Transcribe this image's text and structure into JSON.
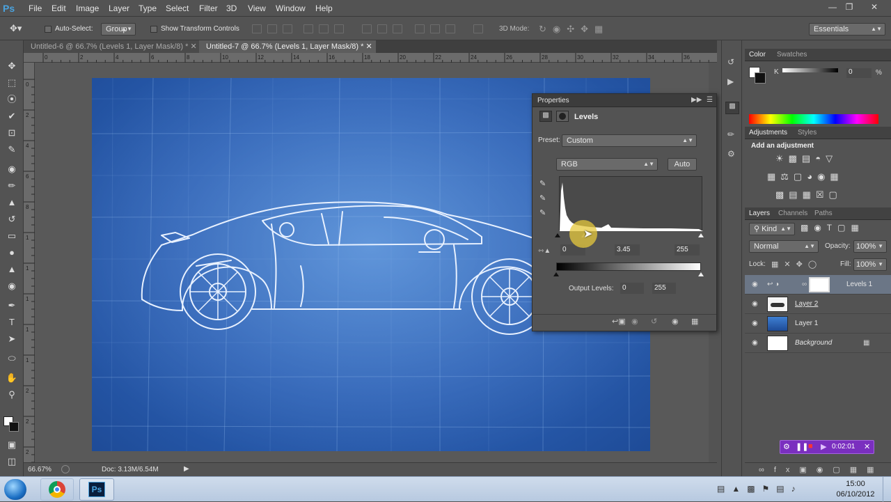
{
  "app": {
    "logo": "Ps"
  },
  "menu": [
    "File",
    "Edit",
    "Image",
    "Layer",
    "Type",
    "Select",
    "Filter",
    "3D",
    "View",
    "Window",
    "Help"
  ],
  "window_controls": [
    "minimize-icon",
    "restore-icon",
    "close-icon"
  ],
  "options": {
    "auto_select_label": "Auto-Select:",
    "auto_select_value": "Group",
    "show_transform_label": "Show Transform Controls",
    "mode_3d_label": "3D Mode:",
    "workspace": "Essentials"
  },
  "tabs": [
    {
      "label": "Untitled-6 @ 66.7% (Levels 1, Layer Mask/8) *",
      "active": false
    },
    {
      "label": "Untitled-7 @ 66.7% (Levels 1, Layer Mask/8) *",
      "active": true
    }
  ],
  "ruler_top_ticks": [
    "0",
    "2",
    "4",
    "6",
    "8",
    "10",
    "12",
    "14",
    "16",
    "18",
    "20",
    "22",
    "24",
    "26",
    "28",
    "30",
    "32",
    "34",
    "36"
  ],
  "ruler_left_ticks": [
    "0",
    "2",
    "4",
    "6",
    "8",
    "1",
    "1",
    "1",
    "1",
    "1",
    "2",
    "2",
    "2"
  ],
  "status": {
    "zoom": "66.67%",
    "doc": "Doc: 3.13M/6.54M"
  },
  "properties": {
    "title": "Properties",
    "panel_name": "Levels",
    "preset_label": "Preset:",
    "preset_value": "Custom",
    "channel": "RGB",
    "auto_label": "Auto",
    "input_black": "0",
    "input_gamma": "3.45",
    "input_white": "255",
    "output_label": "Output Levels:",
    "output_black": "0",
    "output_white": "255"
  },
  "color_panel": {
    "tabs": [
      "Color",
      "Swatches"
    ],
    "k_label": "K",
    "k_value": "0",
    "k_unit": "%"
  },
  "adjustments_panel": {
    "tabs": [
      "Adjustments",
      "Styles"
    ],
    "heading": "Add an adjustment"
  },
  "layers_panel": {
    "tabs": [
      "Layers",
      "Channels",
      "Paths"
    ],
    "kind": "Kind",
    "blend_mode": "Normal",
    "opacity_label": "Opacity:",
    "opacity_value": "100%",
    "lock_label": "Lock:",
    "fill_label": "Fill:",
    "fill_value": "100%",
    "layers": [
      {
        "name": "Levels 1",
        "selected": true
      },
      {
        "name": "Layer 2",
        "selected": false
      },
      {
        "name": "Layer 1",
        "selected": false
      },
      {
        "name": "Background",
        "selected": false
      }
    ]
  },
  "recorder": {
    "time": "0:02:01"
  },
  "taskbar": {
    "time": "15:00",
    "date": "06/10/2012",
    "ps_label": "Ps"
  },
  "colors": {
    "ps_blue": "#4aa3df",
    "blueprint": "#2d63b8",
    "panel": "#535353",
    "panel_dark": "#3c3c3c"
  }
}
